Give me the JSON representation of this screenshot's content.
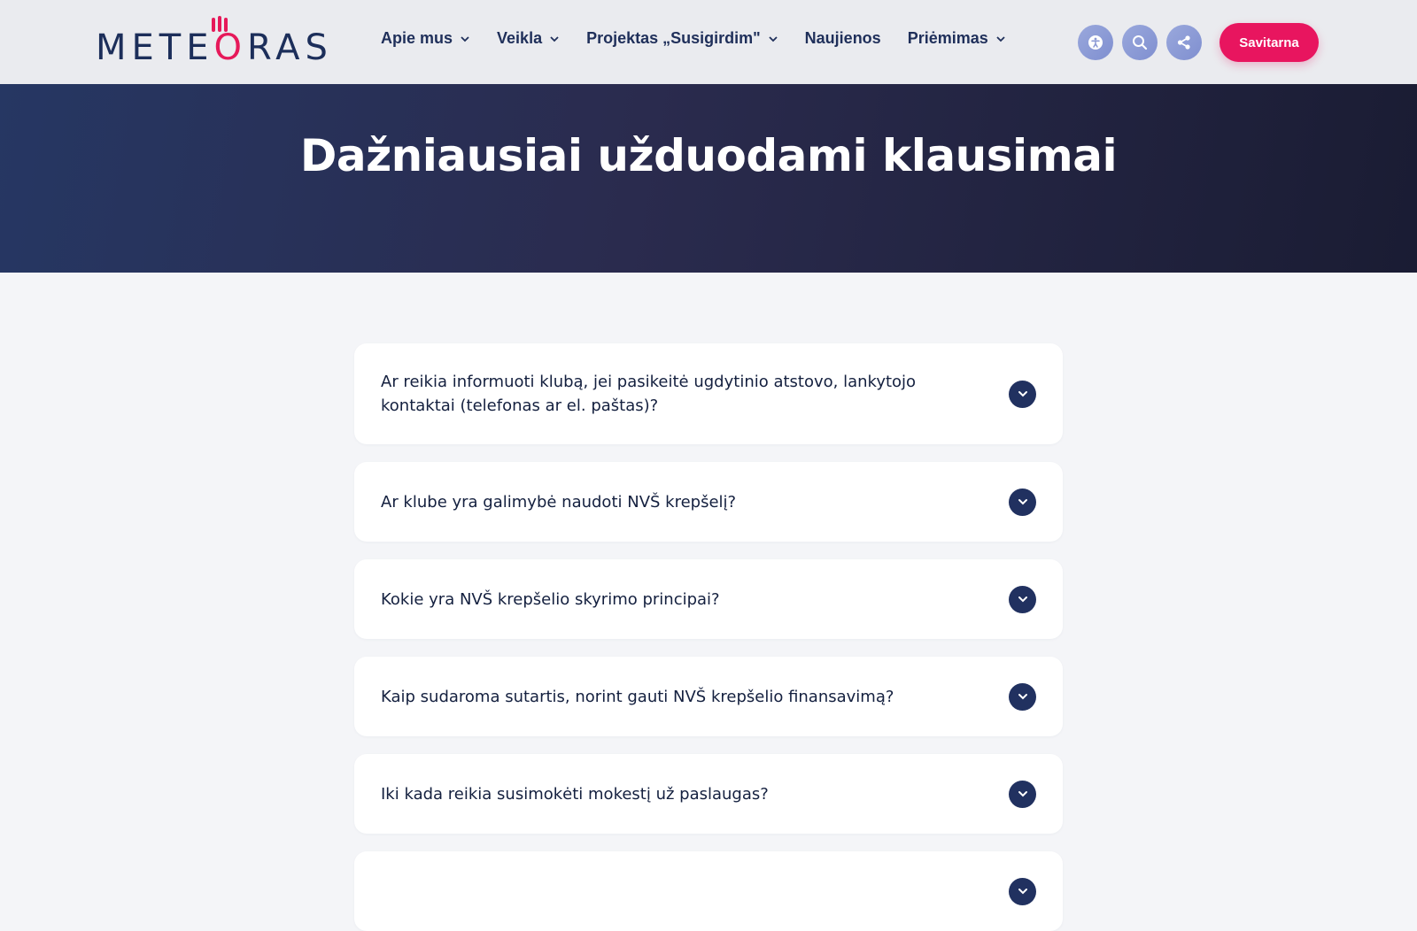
{
  "header": {
    "logo_text_a": "METE",
    "logo_text_o": "O",
    "logo_text_b": "RAS",
    "nav": [
      {
        "label": "Apie mus",
        "has_dropdown": true
      },
      {
        "label": "Veikla",
        "has_dropdown": true
      },
      {
        "label": "Projektas „Susigirdim\"",
        "has_dropdown": true
      },
      {
        "label": "Naujienos",
        "has_dropdown": false
      },
      {
        "label": "Priėmimas",
        "has_dropdown": true
      }
    ],
    "icons": [
      "accessibility-icon",
      "search-icon",
      "share-icon"
    ],
    "cta_label": "Savitarna"
  },
  "hero": {
    "title": "Dažniausiai užduodami klausimai"
  },
  "faq": [
    {
      "question": "Ar reikia informuoti klubą, jei pasikeitė ugdytinio atstovo, lankytojo kontaktai (telefonas ar el. paštas)?"
    },
    {
      "question": "Ar klube yra galimybė naudoti NVŠ krepšelį?"
    },
    {
      "question": "Kokie yra NVŠ krepšelio skyrimo principai?"
    },
    {
      "question": "Kaip sudaroma sutartis, norint gauti NVŠ krepšelio finansavimą?"
    },
    {
      "question": "Iki kada reikia susimokėti mokestį už paslaugas?"
    }
  ],
  "colors": {
    "brand_navy": "#1c2e5a",
    "brand_pink": "#e6195a",
    "toggle_bg": "#213160"
  }
}
